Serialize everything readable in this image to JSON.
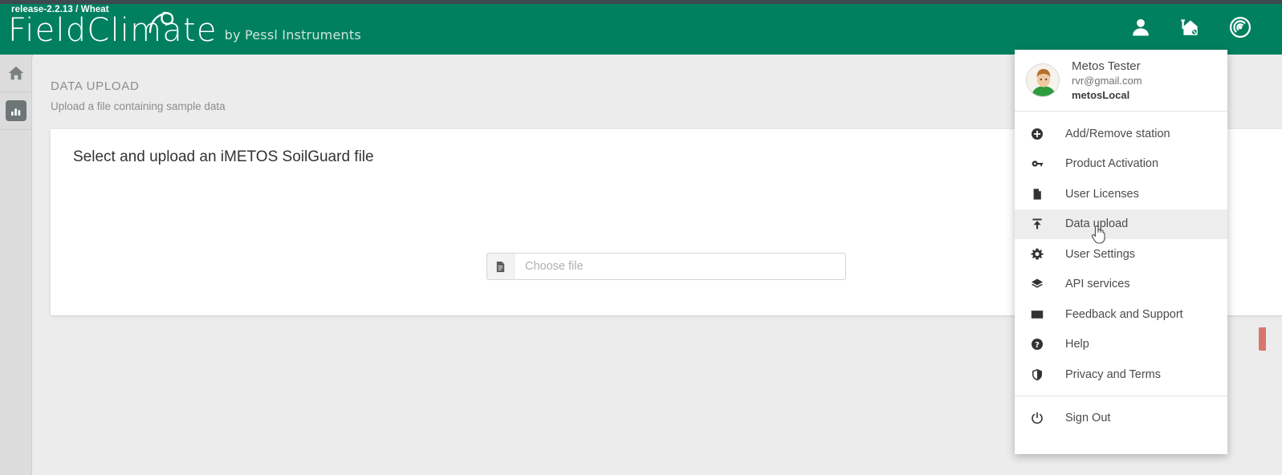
{
  "header": {
    "release": "release-2.2.13 / Wheat",
    "logo_field": "Field",
    "logo_climate": "Climate",
    "logo_by": "by Pessl Instruments",
    "icons": [
      {
        "name": "user-icon",
        "label": "User"
      },
      {
        "name": "station-house-icon",
        "label": "Station"
      },
      {
        "name": "signal-radar-icon",
        "label": "Connectivity"
      }
    ]
  },
  "sidebar": {
    "items": [
      {
        "name": "home-icon",
        "label": "Home",
        "active": false
      },
      {
        "name": "chart-bar-icon",
        "label": "Charts",
        "active": true
      }
    ]
  },
  "page": {
    "title": "DATA UPLOAD",
    "subtitle": "Upload a file containing sample data"
  },
  "card": {
    "title": "Select and upload an iMETOS SoilGuard file",
    "file_input": {
      "value": "",
      "placeholder": "Choose file",
      "button_icon": "document-icon"
    }
  },
  "right_tab": {
    "color": "#d9756f"
  },
  "dropdown": {
    "profile": {
      "name": "Metos Tester",
      "email": "rvr@gmail.com",
      "organization": "metosLocal"
    },
    "items": [
      {
        "label": "Add/Remove station",
        "icon": "plus-circle-icon",
        "highlighted": false
      },
      {
        "label": "Product Activation",
        "icon": "key-icon",
        "highlighted": false
      },
      {
        "label": "User Licenses",
        "icon": "document-icon",
        "highlighted": false
      },
      {
        "label": "Data upload",
        "icon": "upload-icon",
        "highlighted": true
      },
      {
        "label": "User Settings",
        "icon": "gear-icon",
        "highlighted": false
      },
      {
        "label": "API services",
        "icon": "layers-icon",
        "highlighted": false
      },
      {
        "label": "Feedback and Support",
        "icon": "mail-icon",
        "highlighted": false
      },
      {
        "label": "Help",
        "icon": "question-circle-icon",
        "highlighted": false
      },
      {
        "label": "Privacy and Terms",
        "icon": "shield-icon",
        "highlighted": false
      }
    ],
    "sign_out": {
      "label": "Sign Out",
      "icon": "power-icon"
    }
  },
  "colors": {
    "brand_green": "#00805f",
    "top_strip": "#3c4a4f",
    "page_bg": "#ececec",
    "highlight": "#ededed",
    "red_tab": "#d9756f"
  }
}
